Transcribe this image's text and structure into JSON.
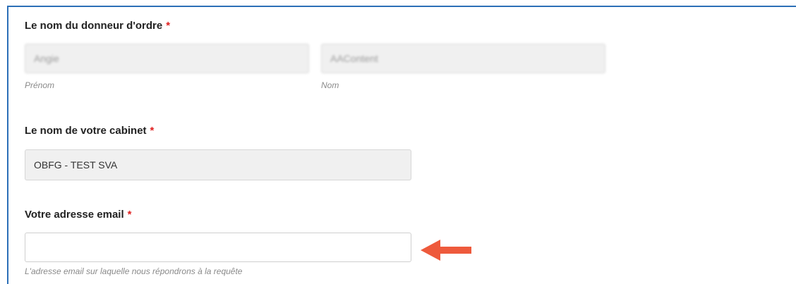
{
  "sections": {
    "client_name": {
      "label": "Le nom du donneur d'ordre",
      "required_mark": "*",
      "first_name_value": "Angie",
      "last_name_value": "AAContent",
      "first_name_caption": "Prénom",
      "last_name_caption": "Nom"
    },
    "firm_name": {
      "label": "Le nom de votre cabinet",
      "required_mark": "*",
      "value": "OBFG - TEST SVA"
    },
    "email": {
      "label": "Votre adresse email",
      "required_mark": "*",
      "value": "",
      "help": "L'adresse email sur laquelle nous répondrons à la requête"
    }
  },
  "colors": {
    "frame_border": "#2c6fb7",
    "required": "#e02020",
    "arrow": "#ee5a3c",
    "field_bg": "#f0f0f0"
  },
  "annotation": {
    "icon": "arrow-left-icon"
  }
}
